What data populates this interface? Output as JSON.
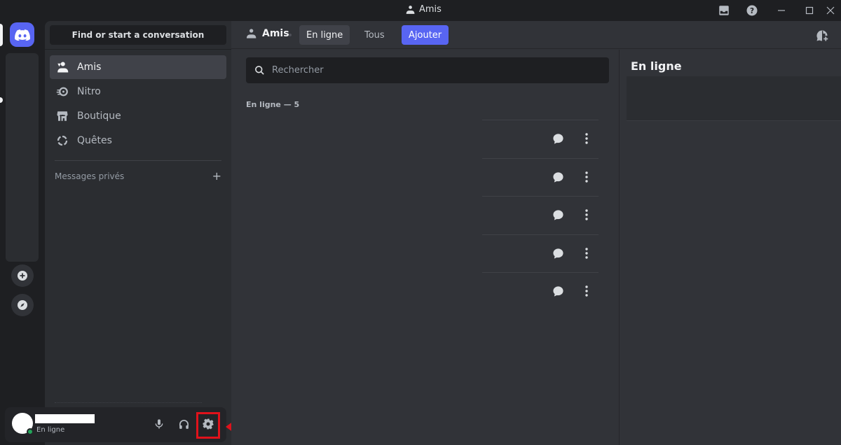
{
  "window": {
    "title": "Amis"
  },
  "sidebar": {
    "search_label": "Find or start a conversation",
    "nav": [
      {
        "label": "Amis",
        "icon": "friends-icon",
        "active": true
      },
      {
        "label": "Nitro",
        "icon": "nitro-icon",
        "active": false
      },
      {
        "label": "Boutique",
        "icon": "shop-icon",
        "active": false
      },
      {
        "label": "Quêtes",
        "icon": "quests-icon",
        "active": false
      }
    ],
    "dm_header": "Messages privés",
    "dm_add": "+"
  },
  "user": {
    "status": "En ligne"
  },
  "header": {
    "title": "Amis",
    "tabs": [
      {
        "label": "En ligne",
        "state": "selected"
      },
      {
        "label": "Tous",
        "state": "normal"
      },
      {
        "label": "Ajouter",
        "state": "primary"
      }
    ]
  },
  "friends": {
    "search_placeholder": "Rechercher",
    "count_label": "En ligne — 5",
    "rows": [
      {},
      {},
      {},
      {},
      {}
    ]
  },
  "activity": {
    "title": "En ligne"
  },
  "colors": {
    "accent": "#5865f2",
    "online": "#23a55a",
    "annotation": "#e0121b"
  }
}
